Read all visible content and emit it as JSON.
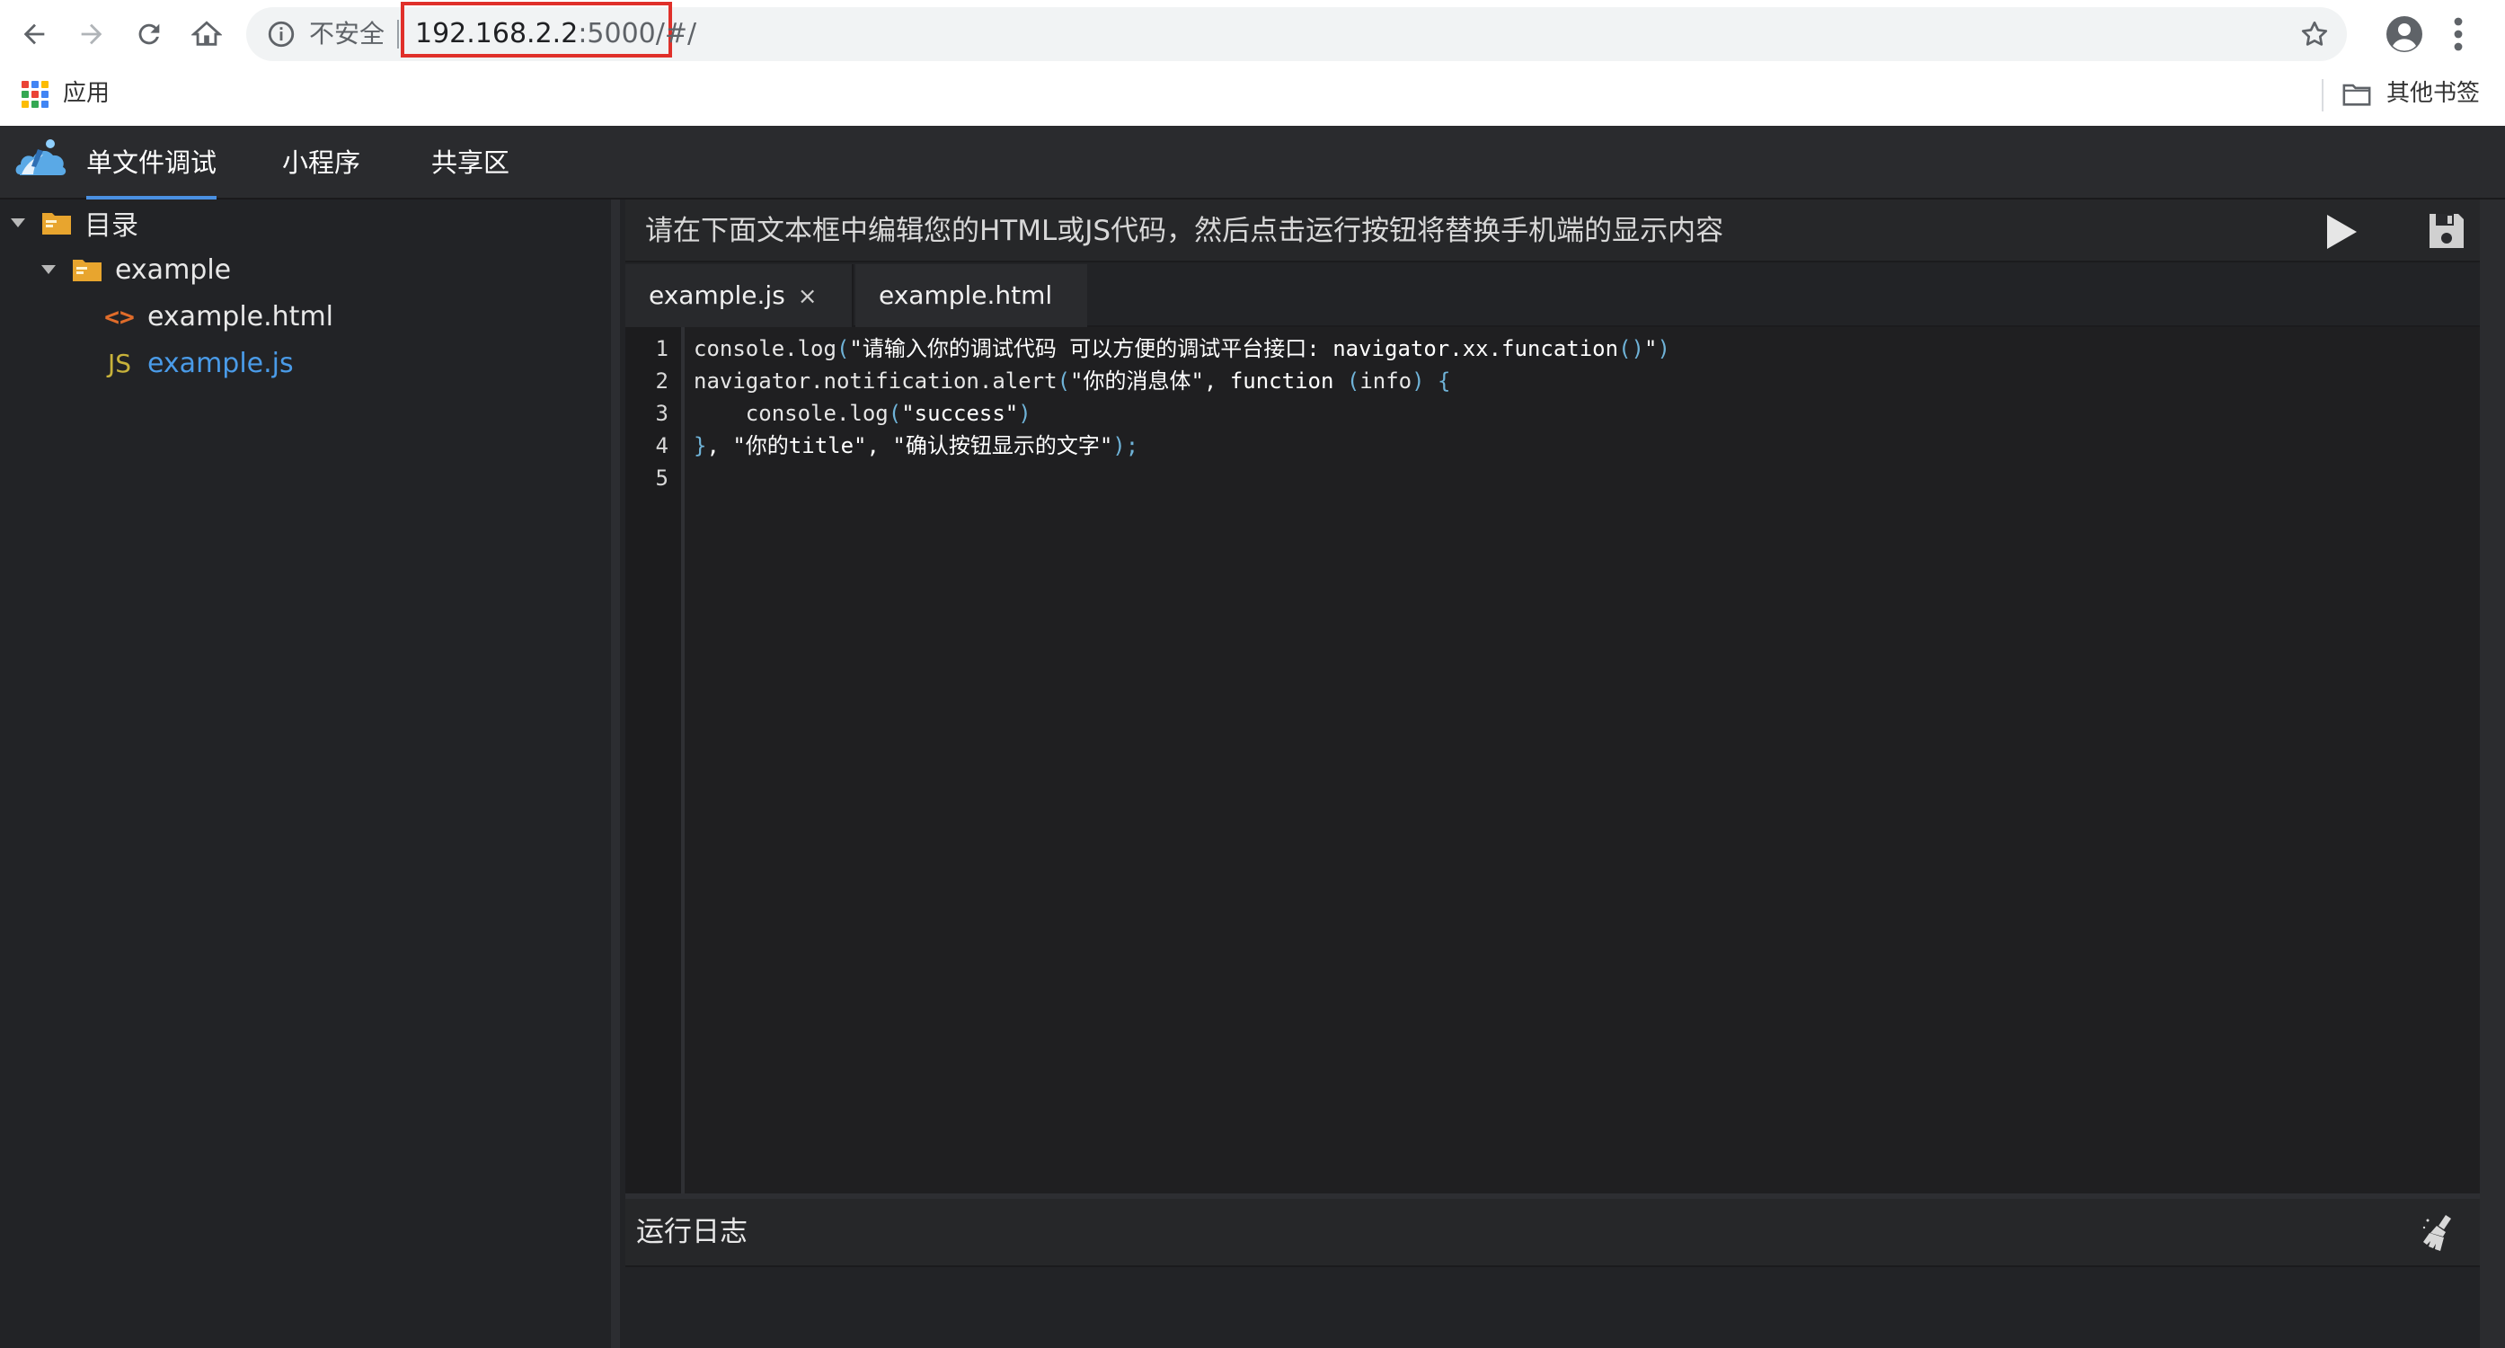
{
  "browser": {
    "security_label": "不安全",
    "url_host": "192.168.2.2",
    "url_rest": ":5000/#/",
    "bookmarks": {
      "apps_label": "应用",
      "other_label": "其他书签"
    }
  },
  "app": {
    "tabs": [
      {
        "label": "单文件调试",
        "active": true
      },
      {
        "label": "小程序",
        "active": false
      },
      {
        "label": "共享区",
        "active": false
      }
    ]
  },
  "sidebar": {
    "root_label": "目录",
    "folder_label": "example",
    "files": [
      {
        "name": "example.html",
        "icon": "html-file-icon",
        "icon_text": "<>",
        "selected": false
      },
      {
        "name": "example.js",
        "icon": "js-file-icon",
        "icon_text": "JS",
        "selected": true
      }
    ]
  },
  "editor": {
    "instruction": "请在下面文本框中编辑您的HTML或JS代码，然后点击运行按钮将替换手机端的显示内容",
    "tabs": [
      {
        "label": "example.js",
        "close": "×",
        "active": true
      },
      {
        "label": "example.html",
        "active": false
      }
    ],
    "line_numbers": [
      "1",
      "2",
      "3",
      "4",
      "5"
    ],
    "code_lines": [
      [
        {
          "t": "console.log",
          "c": ""
        },
        {
          "t": "(",
          "c": "punc"
        },
        {
          "t": "\"请输入你的调试代码 可以方便的调试平台接口: navigator.xx.funcation",
          "c": "str"
        },
        {
          "t": "()",
          "c": "punc"
        },
        {
          "t": "\"",
          "c": "str"
        },
        {
          "t": ")",
          "c": "punc"
        }
      ],
      [
        {
          "t": "navigator.notification.alert",
          "c": ""
        },
        {
          "t": "(",
          "c": "punc"
        },
        {
          "t": "\"你的消息体\", function ",
          "c": "str"
        },
        {
          "t": "(",
          "c": "punc"
        },
        {
          "t": "info",
          "c": ""
        },
        {
          "t": ")",
          "c": "punc"
        },
        {
          "t": " ",
          "c": ""
        },
        {
          "t": "{",
          "c": "punc"
        }
      ],
      [
        {
          "t": "    console.log",
          "c": ""
        },
        {
          "t": "(",
          "c": "punc"
        },
        {
          "t": "\"success\"",
          "c": "str"
        },
        {
          "t": ")",
          "c": "punc"
        }
      ],
      [
        {
          "t": "}",
          "c": "punc"
        },
        {
          "t": ", \"你的title\", \"确认按钮显示的文字\"",
          "c": "str"
        },
        {
          "t": ");",
          "c": "punc"
        }
      ],
      []
    ]
  },
  "log": {
    "title": "运行日志"
  },
  "colors": {
    "accent": "#4a90e2",
    "url_highlight": "#e0302a",
    "background": "#222326",
    "html_icon": "#e06c2a",
    "js_icon": "#c8b23a",
    "selected_file": "#4a9be8"
  }
}
